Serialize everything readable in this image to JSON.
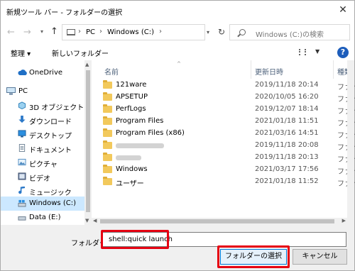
{
  "window": {
    "title": "新規ツール バー - フォルダーの選択",
    "close_glyph": "✕"
  },
  "address": {
    "breadcrumbs": [
      "PC",
      "Windows (C:)"
    ],
    "search_placeholder": "Windows (C:)の検索"
  },
  "toolbar": {
    "organize_label": "整理 ▾",
    "new_folder_label": "新しいフォルダー",
    "help_label": "?"
  },
  "sidebar": {
    "items": [
      {
        "label": "OneDrive",
        "icon": "cloud-icon"
      },
      {
        "label": "PC",
        "icon": "pc-icon"
      },
      {
        "label": "3D オブジェクト",
        "icon": "cube-icon"
      },
      {
        "label": "ダウンロード",
        "icon": "download-icon"
      },
      {
        "label": "デスクトップ",
        "icon": "desktop-icon"
      },
      {
        "label": "ドキュメント",
        "icon": "document-icon"
      },
      {
        "label": "ピクチャ",
        "icon": "pictures-icon"
      },
      {
        "label": "ビデオ",
        "icon": "video-icon"
      },
      {
        "label": "ミュージック",
        "icon": "music-icon"
      },
      {
        "label": "Windows (C:)",
        "icon": "drive-icon",
        "selected": true
      },
      {
        "label": "Data (E:)",
        "icon": "drive-icon"
      }
    ]
  },
  "filelist": {
    "columns": {
      "name": "名前",
      "date": "更新日時",
      "type": "種類"
    },
    "rows": [
      {
        "name": "121ware",
        "date": "2019/11/18 20:14",
        "type": "ファイ"
      },
      {
        "name": "APSETUP",
        "date": "2020/10/05 16:20",
        "type": "ファイ"
      },
      {
        "name": "PerfLogs",
        "date": "2019/12/07 18:14",
        "type": "ファイ"
      },
      {
        "name": "Program Files",
        "date": "2021/01/18 11:51",
        "type": "ファイ"
      },
      {
        "name": "Program Files (x86)",
        "date": "2021/03/16 14:51",
        "type": "ファイ"
      },
      {
        "name": "",
        "date": "2019/11/18 20:08",
        "type": "ファイ",
        "blurred": true
      },
      {
        "name": "",
        "date": "2019/11/18 20:13",
        "type": "ファイ",
        "blurred": true
      },
      {
        "name": "Windows",
        "date": "2021/03/17 17:56",
        "type": "ファイ"
      },
      {
        "name": "ユーザー",
        "date": "2021/01/18 11:52",
        "type": "ファイ"
      }
    ]
  },
  "footer": {
    "folder_label": "フォルダー:",
    "folder_value": "shell:quick launch",
    "select_button": "フォルダーの選択",
    "cancel_button": "キャンセル"
  },
  "colors": {
    "highlight": "#e60012",
    "selected_bg": "#cce8ff",
    "folder": "#f2c95c"
  }
}
